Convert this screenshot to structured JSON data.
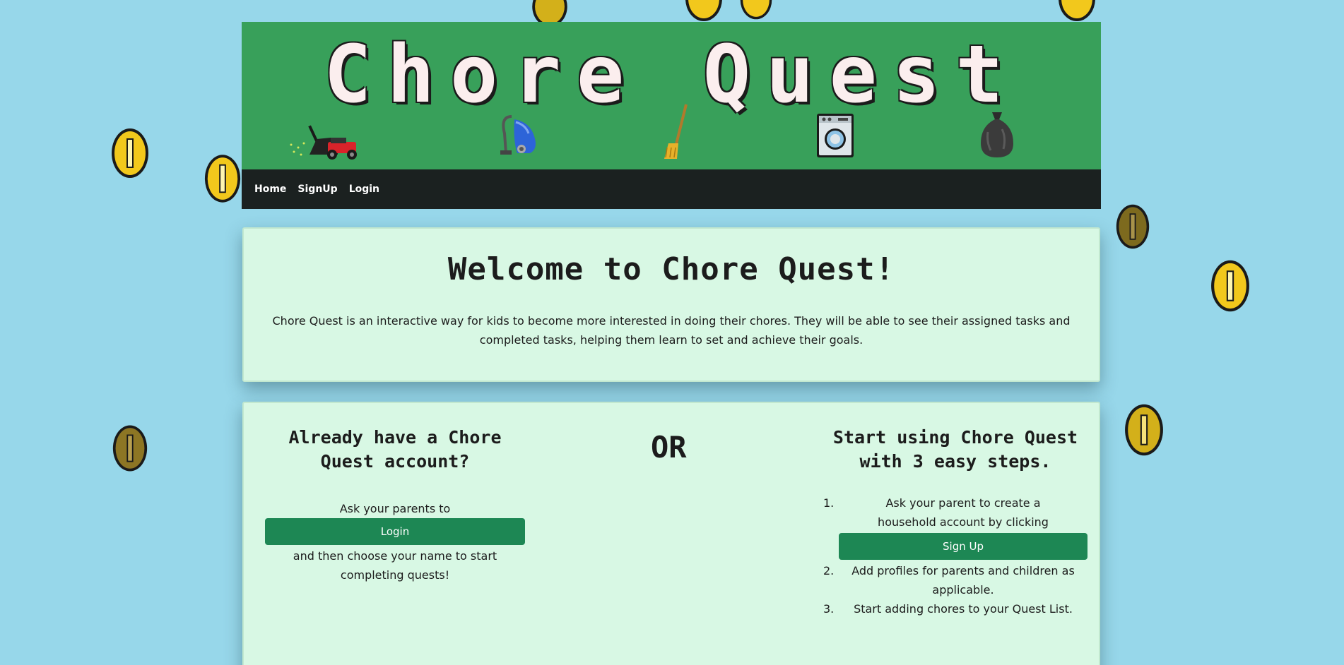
{
  "banner": {
    "title": "Chore Quest",
    "icons": [
      "lawn-mower-icon",
      "vacuum-icon",
      "broom-icon",
      "washing-machine-icon",
      "trash-bag-icon"
    ]
  },
  "nav": {
    "links": [
      "Home",
      "SignUp",
      "Login"
    ]
  },
  "welcome": {
    "heading": "Welcome to Chore Quest!",
    "text": "Chore Quest is an interactive way for kids to become more interested in doing their chores. They will be able to see their assigned tasks and completed tasks, helping them learn to set and achieve their goals."
  },
  "login_section": {
    "heading": "Already have a Chore Quest account?",
    "before": "Ask your parents to",
    "button": "Login",
    "after": "and then choose your name to start completing quests!"
  },
  "or_text": "OR",
  "signup_section": {
    "heading": "Start using Chore Quest with 3 easy steps.",
    "steps": [
      {
        "num": "1.",
        "text": "Ask your parent to create a household account by clicking"
      },
      {
        "num": "2.",
        "text": "Add profiles for parents and children as applicable."
      },
      {
        "num": "3.",
        "text": "Start adding chores to your Quest List."
      }
    ],
    "button": "Sign Up"
  },
  "colors": {
    "background": "#97d7ea",
    "banner": "#38a05a",
    "navbar": "#1b2120",
    "card": "#d8f8e4",
    "button": "#1d8754",
    "coin": "#f2c81c"
  }
}
